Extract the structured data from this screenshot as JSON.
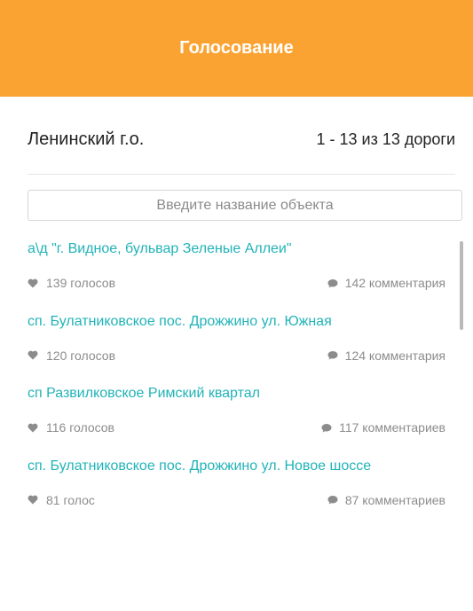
{
  "header": {
    "title": "Голосование"
  },
  "region": {
    "name": "Ленинский г.о.",
    "count_text": "1 - 13 из 13 дороги"
  },
  "search": {
    "placeholder": "Введите название объекта"
  },
  "items": [
    {
      "title": "а\\д \"г. Видное, бульвар Зеленые Аллеи\"",
      "votes": "139 голосов",
      "comments": "142 комментария"
    },
    {
      "title": "сп. Булатниковское пос. Дрожжино ул. Южная",
      "votes": "120 голосов",
      "comments": "124 комментария"
    },
    {
      "title": "сп Развилковское Римский квартал",
      "votes": "116 голосов",
      "comments": "117 комментариев"
    },
    {
      "title": "сп. Булатниковское пос. Дрожжино ул. Новое шоссе",
      "votes": "81 голос",
      "comments": "87 комментариев"
    }
  ],
  "colors": {
    "accent": "#fba332",
    "link": "#22b3b8",
    "muted": "#8c8c8c"
  },
  "icons": {
    "vote": "heart-icon",
    "comment": "comment-icon"
  }
}
